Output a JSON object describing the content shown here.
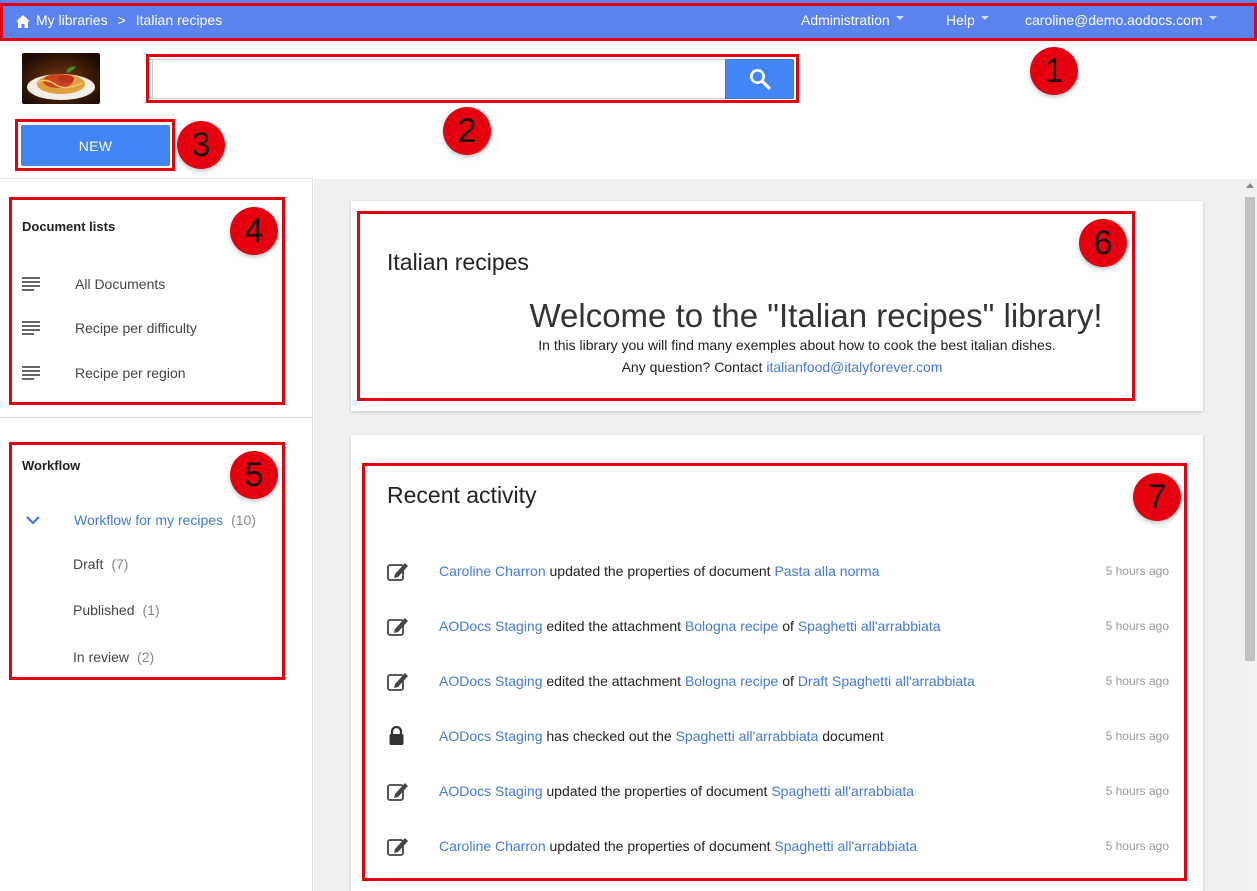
{
  "topbar": {
    "breadcrumb_root": "My libraries",
    "breadcrumb_separator": ">",
    "breadcrumb_current": "Italian recipes",
    "nav": [
      {
        "label": "Administration"
      },
      {
        "label": "Help"
      },
      {
        "label": "caroline@demo.aodocs.com"
      }
    ],
    "color": "#5b83ee"
  },
  "search": {
    "placeholder": "",
    "value": ""
  },
  "new_button": {
    "label": "NEW"
  },
  "sidebar": {
    "document_lists": {
      "title": "Document lists",
      "items": [
        {
          "label": "All Documents"
        },
        {
          "label": "Recipe per difficulty"
        },
        {
          "label": "Recipe per region"
        }
      ]
    },
    "workflow": {
      "title": "Workflow",
      "root": {
        "label": "Workflow for my recipes",
        "count": "(10)"
      },
      "states": [
        {
          "label": "Draft",
          "count": "(7)"
        },
        {
          "label": "Published",
          "count": "(1)"
        },
        {
          "label": "In review",
          "count": "(2)"
        }
      ]
    }
  },
  "welcome_card": {
    "title": "Italian recipes",
    "headline": "Welcome to the \"Italian recipes\" library!",
    "line1": "In this library you will find many exemples about how to cook the best italian dishes.",
    "line2_prefix": "Any question? Contact ",
    "contact_email": "italianfood@italyforever.com"
  },
  "activity_card": {
    "title": "Recent activity",
    "items": [
      {
        "icon": "edit-icon",
        "user": "Caroline Charron",
        "text": " updated the properties of document ",
        "link1": "Pasta alla norma",
        "mid": "",
        "link2": "",
        "tail": "",
        "time": "5 hours ago"
      },
      {
        "icon": "edit-icon",
        "user": "AODocs Staging",
        "text": " edited the attachment ",
        "link1": "Bologna recipe",
        "mid": " of ",
        "link2": "Spaghetti all'arrabbiata",
        "tail": "",
        "time": "5 hours ago"
      },
      {
        "icon": "edit-icon",
        "user": "AODocs Staging",
        "text": " edited the attachment ",
        "link1": "Bologna recipe",
        "mid": " of ",
        "link2": "Draft Spaghetti all'arrabbiata",
        "tail": "",
        "time": "5 hours ago"
      },
      {
        "icon": "lock-icon",
        "user": "AODocs Staging",
        "text": " has checked out the ",
        "link1": "Spaghetti all'arrabbiata",
        "mid": "",
        "link2": "",
        "tail": " document",
        "time": "5 hours ago"
      },
      {
        "icon": "edit-icon",
        "user": "AODocs Staging",
        "text": " updated the properties of document ",
        "link1": "Spaghetti all'arrabbiata",
        "mid": "",
        "link2": "",
        "tail": "",
        "time": "5 hours ago"
      },
      {
        "icon": "edit-icon",
        "user": "Caroline Charron",
        "text": " updated the properties of document ",
        "link1": "Spaghetti all'arrabbiata",
        "mid": "",
        "link2": "",
        "tail": "",
        "time": "5 hours ago"
      }
    ]
  },
  "annotations": [
    "1",
    "2",
    "3",
    "4",
    "5",
    "6",
    "7"
  ]
}
